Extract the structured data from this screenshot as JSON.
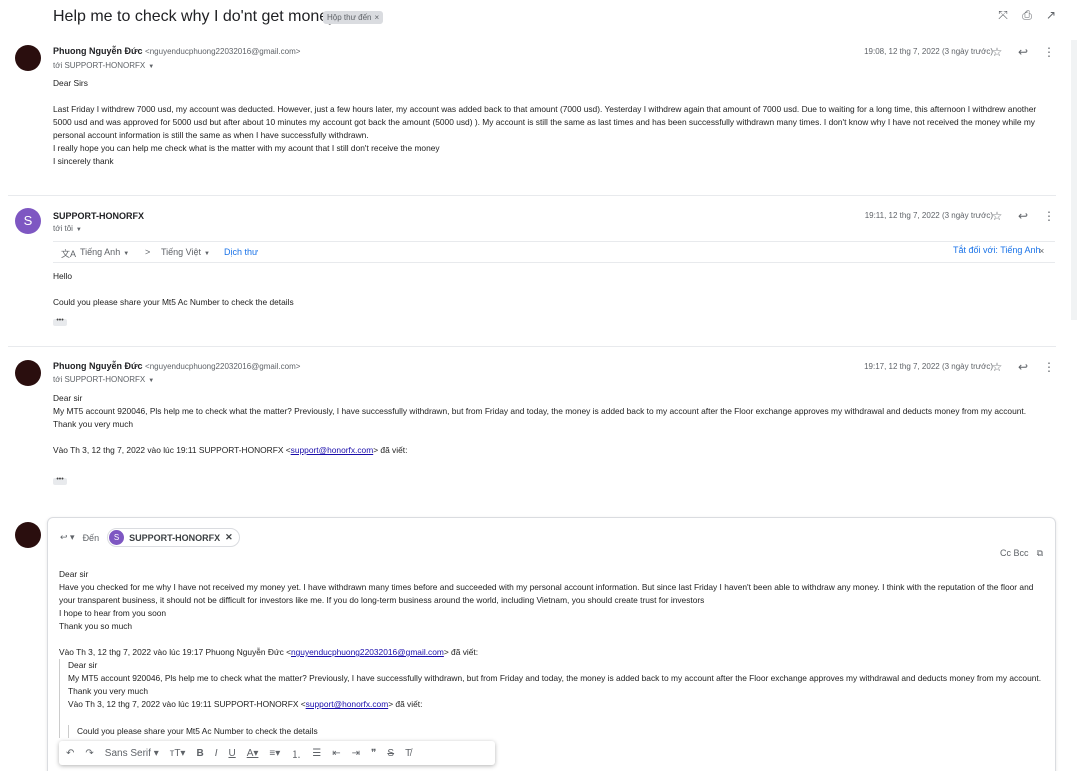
{
  "subject": "Help me to check why I do'nt get money",
  "label": "Hộp thư đến",
  "label_close": "×",
  "top_icons": [
    "collapse-icon",
    "print-icon",
    "open-new-window-icon"
  ],
  "messages": [
    {
      "sender": "Phuong Nguyễn Đức",
      "email": "<nguyenducphuong22032016@gmail.com>",
      "to": "tới SUPPORT-HONORFX",
      "date": "19:08, 12 thg 7, 2022 (3 ngày trước)",
      "body": [
        "Dear Sirs",
        "",
        "Last Friday I withdrew 7000 usd, my account was deducted. However, just a few hours later, my account was added back to that amount (7000 usd). Yesterday I withdrew again that amount of 7000 usd. Due to waiting for a long time, this afternoon I withdrew another 5000 usd and was approved for 5000 usd but after about 10 minutes my account got back the amount (5000 usd) ). My account is still the same as last times and has been successfully withdrawn many times. I don't know why I have not received the money while my personal account information is still the same as when I have successfully withdrawn.",
        "I really hope you can help me check what is  the matter with my acount that I still don't receive the money",
        "I sincerely thank"
      ]
    },
    {
      "sender": "SUPPORT-HONORFX",
      "avatar_letter": "S",
      "to": "tới tôi",
      "date": "19:11, 12 thg 7, 2022 (3 ngày trước)",
      "body": [
        "Hello",
        "",
        "Could you please share your Mt5 Ac Number to check the details"
      ]
    },
    {
      "sender": "Phuong Nguyễn Đức",
      "email": "<nguyenducphuong22032016@gmail.com>",
      "to": "tới SUPPORT-HONORFX",
      "date": "19:17, 12 thg 7, 2022 (3 ngày trước)",
      "body": [
        "Dear sir",
        "My MT5 account 920046, Pls help me to check what the matter? Previously, I have successfully withdrawn, but from Friday and today, the money is added back to my account after the Floor exchange approves my withdrawal and deducts money from my account.",
        " Thank you very much",
        ""
      ],
      "quote_prefix": "Vào Th 3, 12 thg 7, 2022 vào lúc 19:11 SUPPORT-HONORFX <",
      "quote_link": "support@honorfx.com",
      "quote_suffix": "> đã viết:"
    }
  ],
  "translate": {
    "from": "Tiếng Anh",
    "arrow": ">",
    "to": "Tiếng Việt",
    "action": "Dịch thư",
    "turn_off": "Tắt đối với: Tiếng Anh",
    "close": "×"
  },
  "reply": {
    "to_label": "Đến",
    "recipient": "SUPPORT-HONORFX",
    "recipient_letter": "S",
    "cc_bcc": "Cc Bcc",
    "body": [
      "Dear sir",
      "Have you checked for me why I have not received my money yet. I have withdrawn many times before and succeeded with my personal account information. But since last Friday I haven't been able to withdraw any money. I think with the reputation of the floor and your transparent business, it should not be difficult for investors like me. If you do long-term business around the world, including Vietnam, you should create trust for investors",
      "I hope to hear from you soon",
      "Thank you so much"
    ],
    "quote_prefix": "Vào Th 3, 12 thg 7, 2022 vào lúc 19:17 Phuong Nguyễn Đức <",
    "quote_link": "nguyenducphuong22032016@gmail.com",
    "quote_suffix": "> đã viết:",
    "quoted": [
      "Dear sir",
      "My MT5 account 920046, Pls help me to check what the matter? Previously, I have successfully withdrawn, but from Friday and today, the money is added back to my account after the Floor exchange approves my withdrawal and deducts money from my account.",
      " Thank you very much"
    ],
    "quote2_prefix": "Vào Th 3, 12 thg 7, 2022 vào lúc 19:11 SUPPORT-HONORFX <",
    "quote2_link": "support@honorfx.com",
    "quote2_suffix": "> đã viết:",
    "quote2_partial": "Could you please share your Mt5 Ac Number to check the details"
  },
  "format_bar": {
    "font": "Sans Serif"
  }
}
